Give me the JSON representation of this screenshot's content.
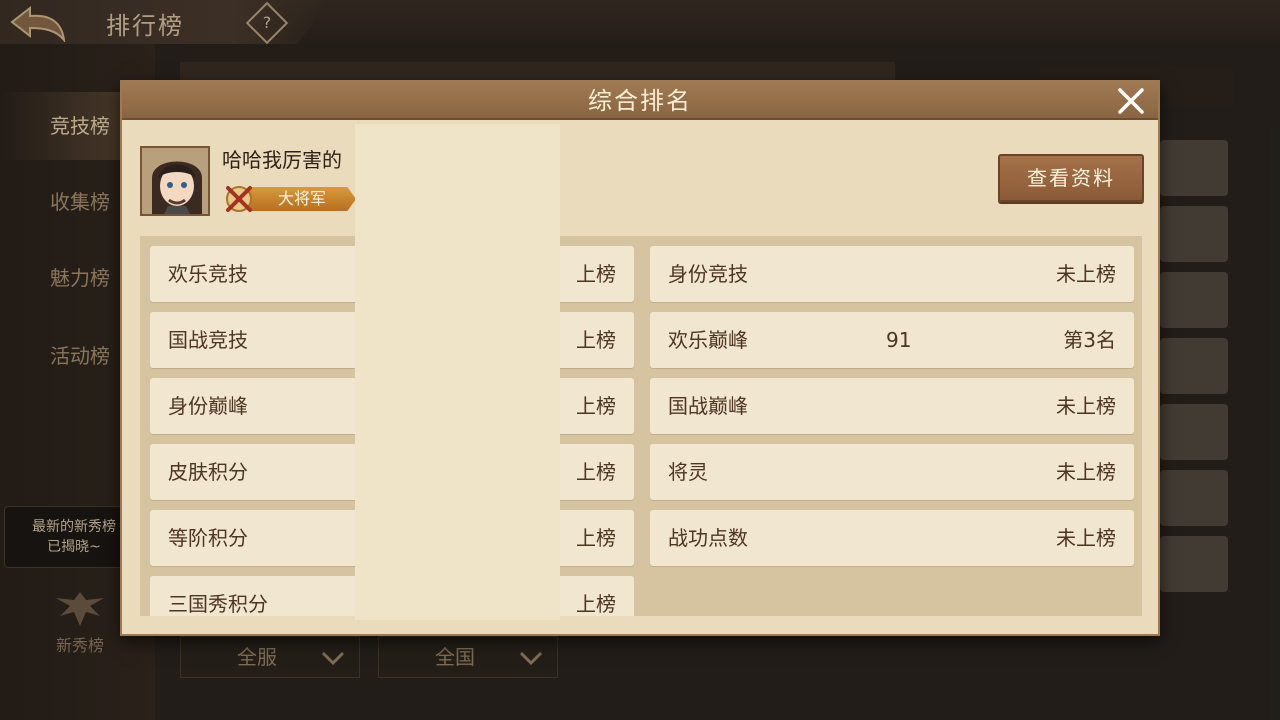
{
  "header": {
    "title": "排行榜",
    "help": "?"
  },
  "left_nav": {
    "items": [
      {
        "label": "竞技榜",
        "active": true
      },
      {
        "label": "收集榜",
        "active": false
      },
      {
        "label": "魅力榜",
        "active": false
      },
      {
        "label": "活动榜",
        "active": false
      }
    ],
    "news_text_1": "最新的新秀榜",
    "news_text_2": "已揭晓~",
    "xinxiu_label": "新秀榜"
  },
  "filters": {
    "server": "全服",
    "region": "全国"
  },
  "modal": {
    "title": "综合排名",
    "player_name": "哈哈我厉害的",
    "rank_title": "大将军",
    "view_button": "查看资料"
  },
  "rankings": {
    "left": [
      {
        "label": "欢乐竞技",
        "status": "上榜"
      },
      {
        "label": "国战竞技",
        "status": "上榜"
      },
      {
        "label": "身份巅峰",
        "status": "上榜"
      },
      {
        "label": "皮肤积分",
        "status": "上榜"
      },
      {
        "label": "等阶积分",
        "status": "上榜"
      },
      {
        "label": "三国秀积分",
        "status": "上榜"
      }
    ],
    "right": [
      {
        "label": "身份竞技",
        "score": "",
        "status": "未上榜"
      },
      {
        "label": "欢乐巅峰",
        "score": "91",
        "status": "第3名"
      },
      {
        "label": "国战巅峰",
        "score": "",
        "status": "未上榜"
      },
      {
        "label": "将灵",
        "score": "",
        "status": "未上榜"
      },
      {
        "label": "战功点数",
        "score": "",
        "status": "未上榜"
      }
    ]
  },
  "icons": {
    "back": "back-arrow-icon",
    "help": "help-icon",
    "close": "close-icon",
    "caret": "chevron-down-icon",
    "emblem": "crossed-swords-icon",
    "phoenix": "phoenix-icon"
  },
  "colors": {
    "modal_bg": "#eadbbd",
    "header_brown": "#8a6543",
    "button_brown": "#8b5b37",
    "badge_orange": "#d99a3b"
  }
}
